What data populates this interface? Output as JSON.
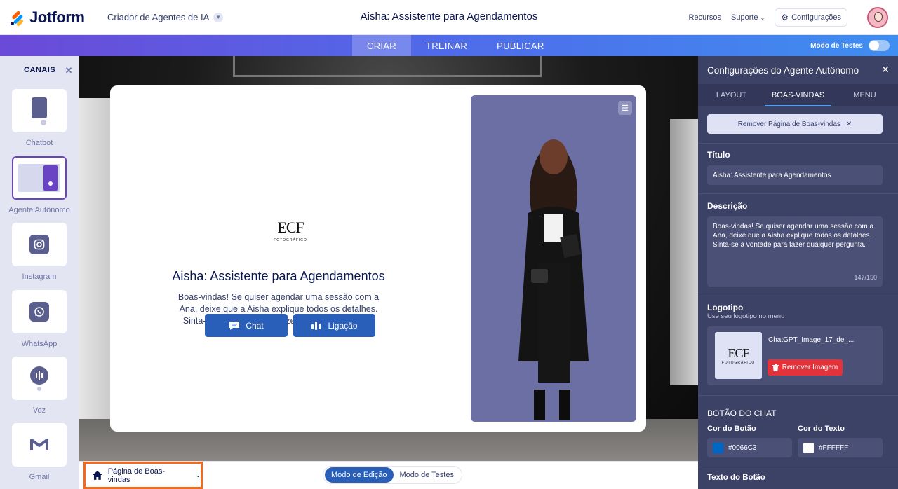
{
  "header": {
    "brand": "Jotform",
    "product": "Criador de Agentes de IA",
    "title": "Aisha: Assistente para Agendamentos",
    "links": [
      "Recursos",
      "Suporte"
    ],
    "settings_label": "Configurações"
  },
  "nav": {
    "tabs": [
      "CRIAR",
      "TREINAR",
      "PUBLICAR"
    ],
    "active_tab": "CRIAR",
    "test_mode_label": "Modo de Testes"
  },
  "sidebar": {
    "title": "CANAIS",
    "items": [
      {
        "label": "Chatbot",
        "icon": "chatbot-icon"
      },
      {
        "label": "Agente Autônomo",
        "icon": "standalone-agent-icon"
      },
      {
        "label": "Instagram",
        "icon": "instagram-icon"
      },
      {
        "label": "WhatsApp",
        "icon": "whatsapp-icon"
      },
      {
        "label": "Voz",
        "icon": "voice-icon"
      },
      {
        "label": "Gmail",
        "icon": "gmail-icon"
      }
    ],
    "selected": "Agente Autônomo"
  },
  "preview": {
    "logo_text": "ECF",
    "logo_sub": "FOTOGRÁFICO",
    "title": "Aisha: Assistente para Agendamentos",
    "description": "Boas-vindas! Se quiser agendar uma sessão com a Ana, deixe que a Aisha explique todos os detalhes. Sinta-se à vontade para fazer qualquer pergunta.",
    "buttons": [
      {
        "label": "Chat",
        "icon": "chat-icon"
      },
      {
        "label": "Ligação",
        "icon": "call-wave-icon"
      }
    ]
  },
  "bottom_bar": {
    "page_select": "Página de Boas-vindas",
    "modes": [
      "Modo de Edição",
      "Modo de Testes"
    ],
    "active_mode": "Modo de Edição"
  },
  "panel": {
    "title": "Configurações do Agente Autônomo",
    "tabs": [
      "LAYOUT",
      "BOAS-VINDAS",
      "MENU"
    ],
    "active_tab": "BOAS-VINDAS",
    "remove_page_label": "Remover Página de Boas-vindas",
    "title_label": "Título",
    "title_value": "Aisha: Assistente para Agendamentos",
    "description_label": "Descrição",
    "description_value": "Boas-vindas! Se quiser agendar uma sessão com a Ana, deixe que a Aisha explique todos os detalhes. Sinta-se à vontade para fazer qualquer pergunta.",
    "description_count": "147/150",
    "logo_label": "Logotipo",
    "logo_sub": "Use seu logotipo no menu",
    "logo_filename": "ChatGPT_Image_17_de_...",
    "remove_image_label": "Remover Imagem",
    "chat_button_section": "BOTÃO DO CHAT",
    "button_color_label": "Cor do Botão",
    "button_color_value": "#0066C3",
    "text_color_label": "Cor do Texto",
    "text_color_value": "#FFFFFF",
    "button_text_label": "Texto do Botão"
  },
  "colors": {
    "brand_blue": "#2a5fb9",
    "panel_bg": "#3c4166",
    "highlight_orange": "#f26a1b",
    "danger": "#e3323a"
  }
}
